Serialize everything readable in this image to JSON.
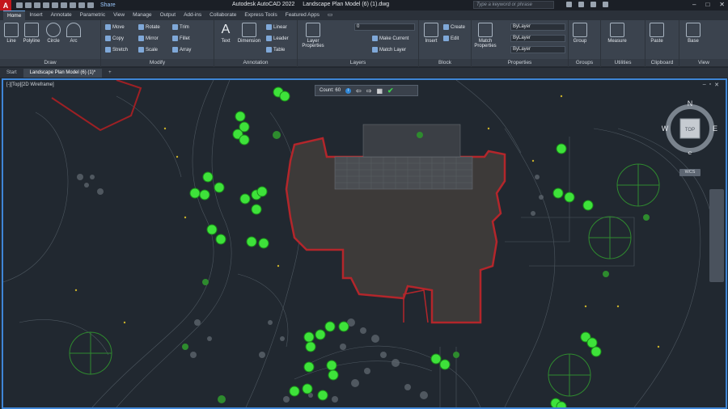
{
  "titlebar": {
    "app_title": "Autodesk AutoCAD 2022",
    "file_title": "Landscape Plan Model (6) (1).dwg",
    "share_label": "Share",
    "search_placeholder": "Type a keyword or phrase"
  },
  "ribbon_tabs": [
    "Home",
    "Insert",
    "Annotate",
    "Parametric",
    "View",
    "Manage",
    "Output",
    "Add-ins",
    "Collaborate",
    "Express Tools",
    "Featured Apps"
  ],
  "ribbon": {
    "draw": {
      "label": "Draw",
      "line": "Line",
      "polyline": "Polyline",
      "circle": "Circle",
      "arc": "Arc"
    },
    "modify": {
      "label": "Modify",
      "move": "Move",
      "rotate": "Rotate",
      "trim": "Trim",
      "copy": "Copy",
      "mirror": "Mirror",
      "fillet": "Fillet",
      "stretch": "Stretch",
      "scale": "Scale",
      "array": "Array"
    },
    "annotation": {
      "label": "Annotation",
      "text": "Text",
      "dimension": "Dimension",
      "linear": "Linear",
      "leader": "Leader",
      "table": "Table"
    },
    "layers": {
      "label": "Layers",
      "layer_properties": "Layer Properties",
      "current_layer": "0",
      "make_current": "Make Current",
      "match_layer": "Match Layer"
    },
    "block": {
      "label": "Block",
      "insert": "Insert",
      "create": "Create",
      "edit": "Edit"
    },
    "properties": {
      "label": "Properties",
      "match_properties": "Match Properties",
      "color": "ByLayer",
      "linetype": "ByLayer",
      "lineweight": "ByLayer"
    },
    "groups": {
      "label": "Groups",
      "group": "Group"
    },
    "utilities": {
      "label": "Utilities",
      "measure": "Measure"
    },
    "clipboard": {
      "label": "Clipboard",
      "paste": "Paste"
    },
    "view": {
      "label": "View",
      "base": "Base"
    }
  },
  "file_tabs": [
    "Start",
    "Landscape Plan Model (6) (1)*"
  ],
  "viewport": {
    "label": "[-][Top][2D Wireframe]",
    "count_label": "Count:",
    "count_value": "60",
    "viewcube": {
      "top": "TOP",
      "n": "N",
      "s": "S",
      "e": "E",
      "w": "W"
    },
    "wcs": "WCS"
  },
  "colors": {
    "accent": "#3f86d6",
    "highlight": "#3ee23a",
    "building_outline": "#b3262b"
  }
}
